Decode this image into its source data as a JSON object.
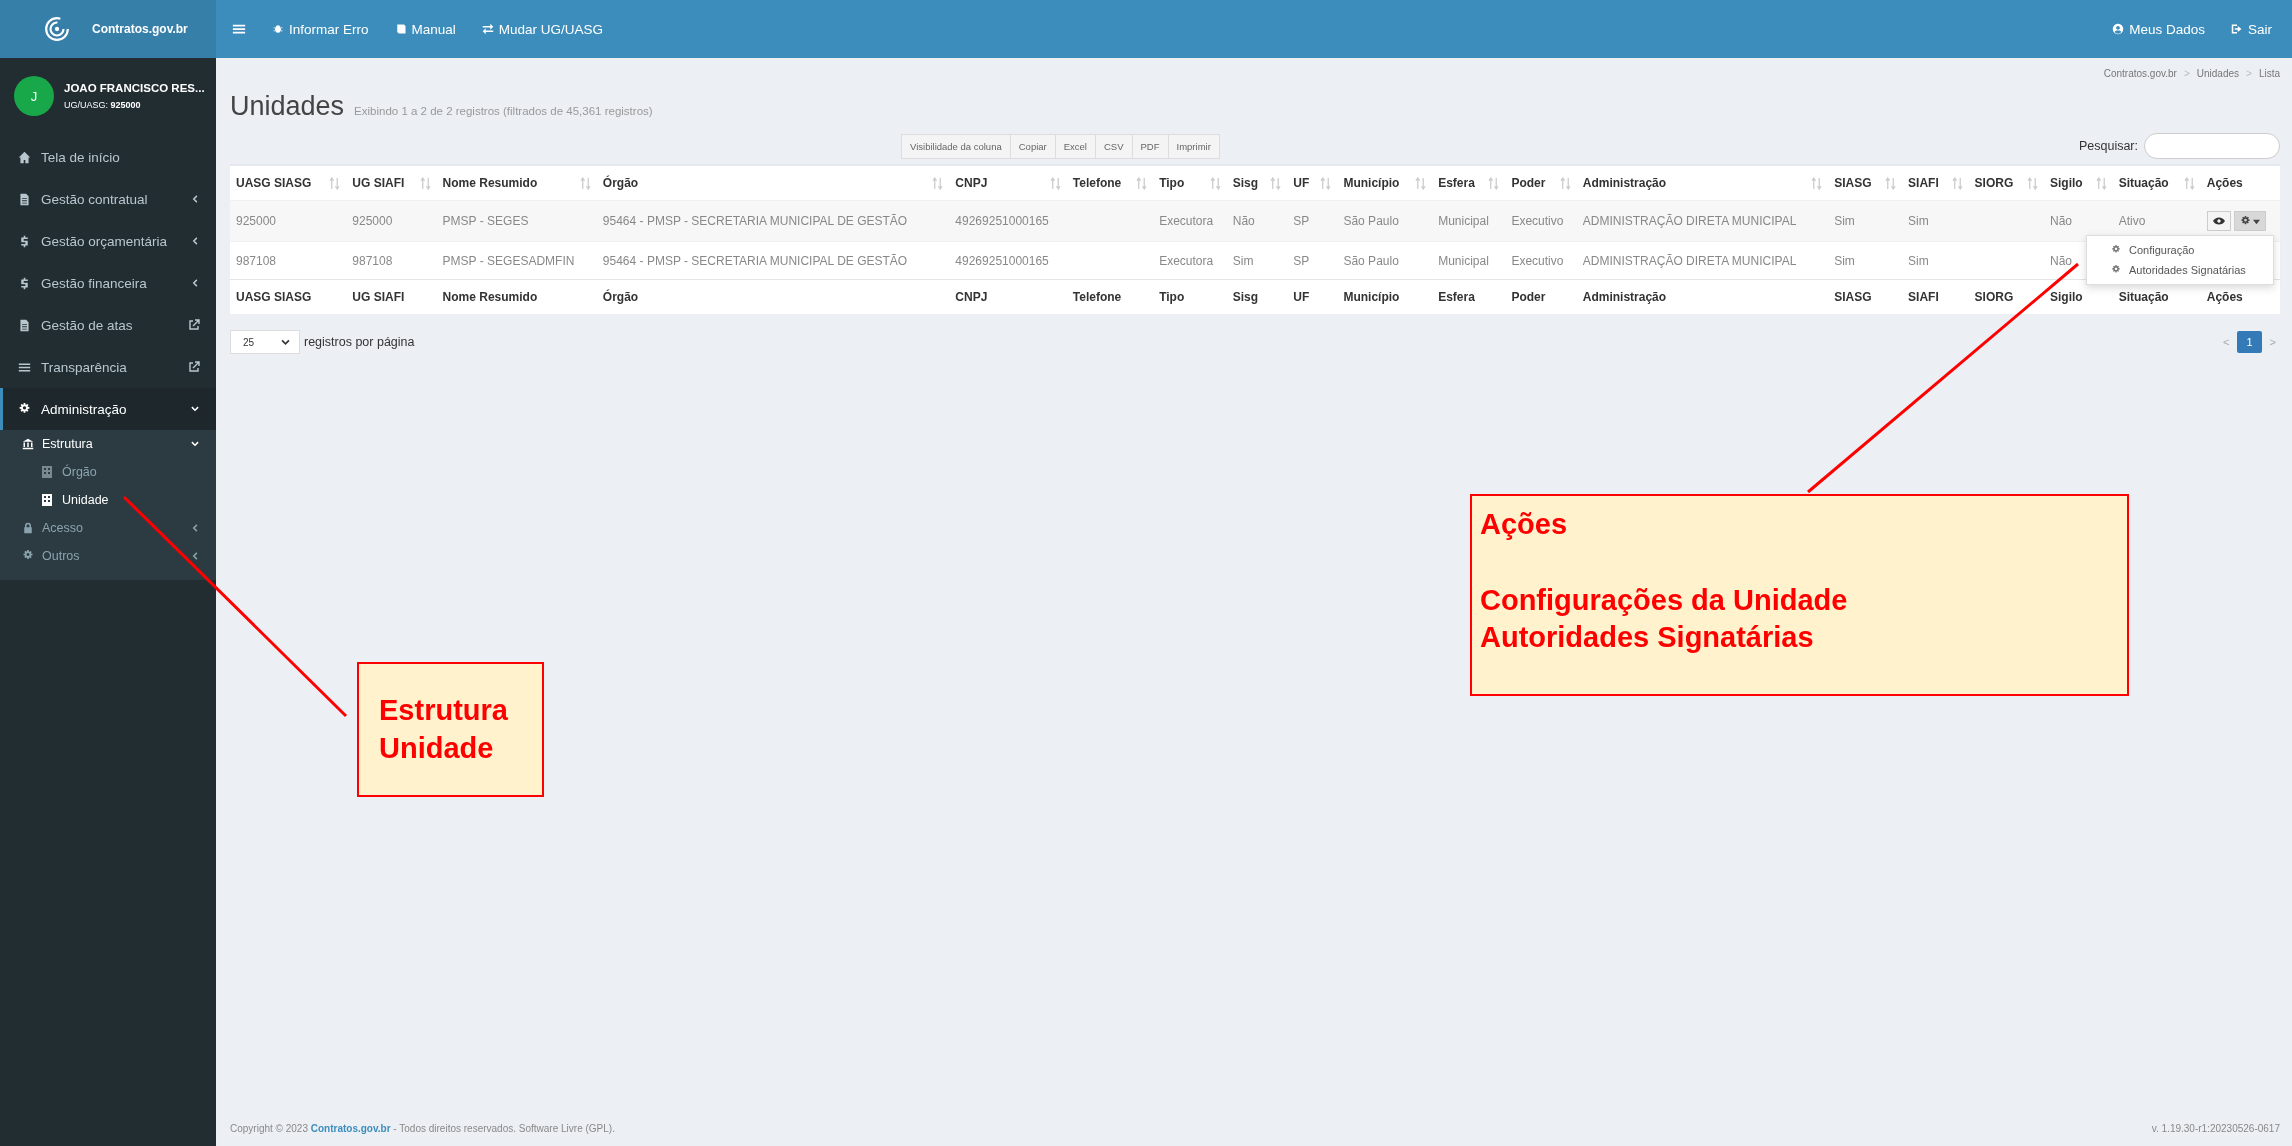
{
  "topbar": {
    "logo_text": "Contratos.gov.br",
    "nav": [
      {
        "label": "Informar Erro"
      },
      {
        "label": "Manual"
      },
      {
        "label": "Mudar UG/UASG"
      }
    ],
    "right": [
      {
        "label": "Meus Dados"
      },
      {
        "label": "Sair"
      }
    ]
  },
  "user": {
    "initial": "J",
    "name": "JOAO FRANCISCO RES...",
    "ug": "UG/UASG: **925000**"
  },
  "sidebar": {
    "items": [
      {
        "label": "Tela de início",
        "kind": "link",
        "selected": false
      },
      {
        "label": "Gestão contratual",
        "kind": "menu",
        "selected": false,
        "expanded": false
      },
      {
        "label": "Gestão orçamentária",
        "kind": "menu",
        "selected": false,
        "expanded": false
      },
      {
        "label": "Gestão financeira",
        "kind": "menu",
        "selected": false,
        "expanded": false
      },
      {
        "label": "Gestão de atas",
        "kind": "external",
        "selected": false
      },
      {
        "label": "Transparência",
        "kind": "external",
        "selected": false
      },
      {
        "label": "Administração",
        "kind": "menu",
        "selected": true,
        "expanded": true,
        "children": [
          {
            "label": "Estrutura",
            "expanded": true,
            "children": [
              {
                "label": "Órgão",
                "selected": false
              },
              {
                "label": "Unidade",
                "selected": true
              }
            ]
          },
          {
            "label": "Acesso",
            "expanded": false
          },
          {
            "label": "Outros",
            "expanded": false
          }
        ]
      }
    ]
  },
  "page": {
    "title": "Unidades",
    "subtitle": "Exibindo 1 a 2 de 2 registros (filtrados de 45,361 registros)",
    "breadcrumb": [
      "Contratos.gov.br",
      "Unidades",
      "Lista"
    ],
    "breadcrumb_separator": ">",
    "export_buttons": [
      "Visibilidade da coluna",
      "Copiar",
      "Excel",
      "CSV",
      "PDF",
      "Imprimir"
    ],
    "search_label": "Pesquisar:"
  },
  "table": {
    "columns": [
      {
        "label": "UASG SIASG",
        "sortable": true
      },
      {
        "label": "UG SIAFI",
        "sortable": true
      },
      {
        "label": "Nome Resumido",
        "sortable": true
      },
      {
        "label": "Órgão",
        "sortable": true
      },
      {
        "label": "CNPJ",
        "sortable": true
      },
      {
        "label": "Telefone",
        "sortable": true
      },
      {
        "label": "Tipo",
        "sortable": true
      },
      {
        "label": "Sisg",
        "sortable": true
      },
      {
        "label": "UF",
        "sortable": true
      },
      {
        "label": "Município",
        "sortable": true
      },
      {
        "label": "Esfera",
        "sortable": true
      },
      {
        "label": "Poder",
        "sortable": true
      },
      {
        "label": "Administração",
        "sortable": true
      },
      {
        "label": "SIASG",
        "sortable": true
      },
      {
        "label": "SIAFI",
        "sortable": true
      },
      {
        "label": "SIORG",
        "sortable": true
      },
      {
        "label": "Sigilo",
        "sortable": true
      },
      {
        "label": "Situação",
        "sortable": true
      },
      {
        "label": "Ações",
        "sortable": false
      }
    ],
    "rows": [
      {
        "cells": [
          "925000",
          "925000",
          "PMSP - SEGES",
          "95464 - PMSP - SECRETARIA MUNICIPAL DE GESTÃO",
          "49269251000165",
          null,
          "Executora",
          "Não",
          "SP",
          "São Paulo",
          "Municipal",
          "Executivo",
          "ADMINISTRAÇÃO DIRETA MUNICIPAL",
          "Sim",
          "Sim",
          null,
          "Não",
          "Ativo"
        ],
        "menu_open": true
      },
      {
        "cells": [
          "987108",
          "987108",
          "PMSP - SEGESADMFIN",
          "95464 - PMSP - SECRETARIA MUNICIPAL DE GESTÃO",
          "49269251000165",
          null,
          "Executora",
          "Sim",
          "SP",
          "São Paulo",
          "Municipal",
          "Executivo",
          "ADMINISTRAÇÃO DIRETA MUNICIPAL",
          "Sim",
          "Sim",
          null,
          "Não",
          null
        ]
      }
    ],
    "footer_columns": [
      "UASG SIASG",
      "UG SIAFI",
      "Nome Resumido",
      "Órgão",
      "CNPJ",
      "Telefone",
      "Tipo",
      "Sisg",
      "UF",
      "Município",
      "Esfera",
      "Poder",
      "Administração",
      "SIASG",
      "SIAFI",
      "SIORG",
      "Sigilo",
      "Situação",
      "Ações"
    ],
    "action_menu": [
      "Configuração",
      "Autoridades Signatárias"
    ]
  },
  "length": {
    "value": "25",
    "label": "registros por página"
  },
  "pagination": {
    "prev": "<",
    "next": ">",
    "pages": [
      {
        "label": "1",
        "selected": true
      }
    ]
  },
  "footer": {
    "prefix": "Copyright © 2023",
    "link": "Contratos.gov.br",
    "suffix": "- Todos direitos reservados. Software Livre (GPL).",
    "version": "v. 1.19.30-r1:20230526-0617"
  },
  "annotations": [
    {
      "lines": [
        "Estrutura",
        "Unidade"
      ]
    },
    {
      "title": "Ações",
      "lines": [
        "Configurações da Unidade",
        "Autoridades Signatárias"
      ]
    }
  ]
}
